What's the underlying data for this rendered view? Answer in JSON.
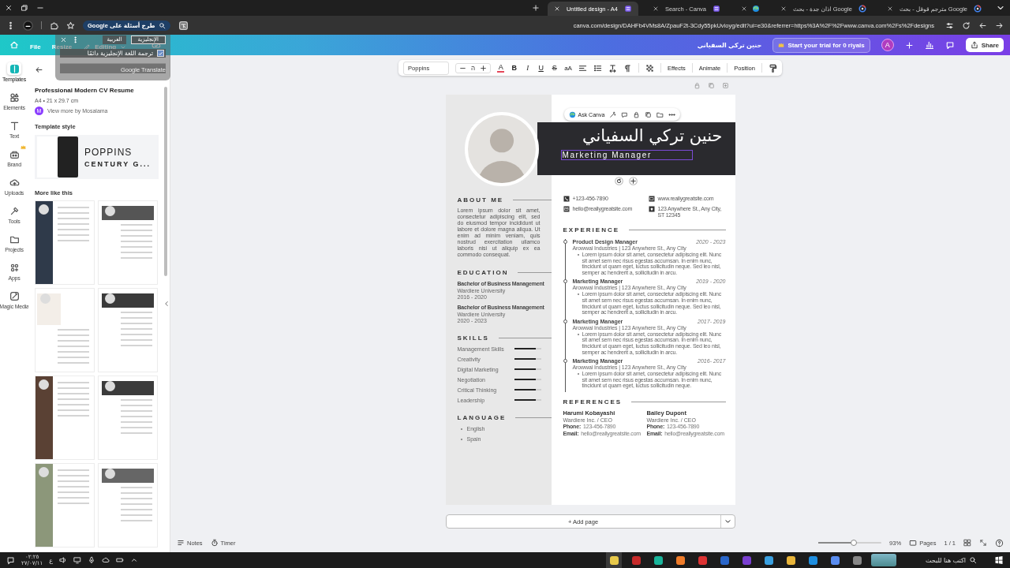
{
  "browser": {
    "tabs": [
      {
        "kind": "page",
        "title": "Untitled design - A4",
        "selected": true
      },
      {
        "kind": "page",
        "title": "Search - Canva",
        "selected": false
      },
      {
        "kind": "pinned",
        "selected": false
      },
      {
        "kind": "page",
        "title": "اذان جدة - بحث Google",
        "selected": false
      },
      {
        "kind": "page",
        "title": "مترجم قوقل - بحث Google",
        "selected": false
      }
    ],
    "ask_google": "طرح أسئلة على Google",
    "url": "canva.com/design/DAHFb4VMs8A/ZpauF2t-3Cdy55pkUvioyg/edit?ui=e30&referrer=https%3A%2F%2Fwww.canva.com%2Fs%2Fdesigns"
  },
  "translate_popup": {
    "languages": [
      {
        "label": "الإنجليزية",
        "selected": true
      },
      {
        "label": "العربية",
        "selected": false
      }
    ],
    "always": {
      "label": "ترجمة اللغة الإنجليزية دائمًا",
      "checked": true
    },
    "footer": "Google Translate"
  },
  "header": {
    "menu": [
      "File",
      "Resize",
      "Editing"
    ],
    "design_title": "حنين تركي السفياني",
    "trial": "Start your trial for 0 riyals",
    "avatar": "A",
    "share": "Share"
  },
  "rail": [
    {
      "label": "Templates",
      "selected": true,
      "premium": false
    },
    {
      "label": "Elements",
      "selected": false,
      "premium": false
    },
    {
      "label": "Text",
      "selected": false,
      "premium": false
    },
    {
      "label": "Brand",
      "selected": false,
      "premium": true
    },
    {
      "label": "Uploads",
      "selected": false,
      "premium": false
    },
    {
      "label": "Tools",
      "selected": false,
      "premium": false
    },
    {
      "label": "Projects",
      "selected": false,
      "premium": false
    },
    {
      "label": "Apps",
      "selected": false,
      "premium": false
    },
    {
      "label": "Magic Media",
      "selected": false,
      "premium": false
    }
  ],
  "panel": {
    "title": "Professional Modern CV Resume",
    "size": "A4 • 21 x 29.7 cm",
    "author_initial": "M",
    "author_link": "View more by Mosalama",
    "style_heading": "Template style",
    "style_fonts": [
      "POPPINS",
      "CENTURY G..."
    ],
    "more_heading": "More like this"
  },
  "text_toolbar": {
    "font": "Poppins",
    "size": "ה",
    "text_color": "A",
    "format": [
      {
        "kind": "bold",
        "label": "B"
      },
      {
        "kind": "italic",
        "label": "I"
      },
      {
        "kind": "underline",
        "label": "U"
      },
      {
        "kind": "strike",
        "label": "S"
      },
      {
        "kind": "case",
        "label": "aA"
      }
    ],
    "actions": [
      "Effects",
      "Animate",
      "Position"
    ]
  },
  "ask_canva": "Ask Canva",
  "resume": {
    "name": "حنين تركي السفياني",
    "title": "Marketing Manager",
    "about": {
      "heading": "ABOUT ME",
      "text": "Lorem ipsum dolor sit amet, consectetur adipiscing elit, sed do eiusmod tempor incididunt ut labore et dolore magna aliqua. Ut enim ad minim veniam, quis nostrud exercitation ullamco laboris nisi ut aliquip ex ea commodo consequat."
    },
    "education": {
      "heading": "EDUCATION",
      "entries": [
        {
          "degree": "Bachelor of Business Management",
          "school": "Wardiere University",
          "years": "2016 - 2020"
        },
        {
          "degree": "Bachelor of Business Management",
          "school": "Wardiere University",
          "years": "2020 - 2023"
        }
      ]
    },
    "skills": {
      "heading": "SKILLS",
      "items": [
        {
          "name": "Management Skills",
          "level": 0.8
        },
        {
          "name": "Creativity",
          "level": 0.8
        },
        {
          "name": "Digital Marketing",
          "level": 0.8
        },
        {
          "name": "Negotiation",
          "level": 0.8
        },
        {
          "name": "Critical Thinking",
          "level": 0.8
        },
        {
          "name": "Leadership",
          "level": 0.8
        }
      ]
    },
    "language": {
      "heading": "LANGUAGE",
      "items": [
        "English",
        "Spain"
      ]
    },
    "contacts": [
      {
        "kind": "phone",
        "text": "+123-456-7890"
      },
      {
        "kind": "web",
        "text": "www.reallygreatsite.com"
      },
      {
        "kind": "email",
        "text": "hello@reallygreatsite.com"
      },
      {
        "kind": "address",
        "text": "123 Anywhere St., Any City, ST 12345"
      }
    ],
    "experience": {
      "heading": "EXPERIENCE",
      "jobs": [
        {
          "title": "Product Design Manager",
          "dates": "2020 - 2023",
          "company": "Arowwai Industries | 123 Anywhere St., Any City",
          "text": "Lorem ipsum dolor sit amet, consectetur adipiscing elit. Nunc sit amet sem nec risus egestas accumsan. In enim nunc, tincidunt ut quam eget, luctus sollicitudin neque. Sed leo nisl, semper ac hendrerit a, sollicitudin in arcu."
        },
        {
          "title": "Marketing Manager",
          "dates": "2019 - 2020",
          "company": "Arowwai Industries | 123 Anywhere St., Any City",
          "text": "Lorem ipsum dolor sit amet, consectetur adipiscing elit. Nunc sit amet sem nec risus egestas accumsan. In enim nunc, tincidunt ut quam eget, luctus sollicitudin neque. Sed leo nisl, semper ac hendrerit a, sollicitudin in arcu."
        },
        {
          "title": "Marketing Manager",
          "dates": "2017- 2019",
          "company": "Arowwai Industries | 123 Anywhere St., Any City",
          "text": "Lorem ipsum dolor sit amet, consectetur adipiscing elit. Nunc sit amet sem nec risus egestas accumsan. In enim nunc, tincidunt ut quam eget, luctus sollicitudin neque. Sed leo nisl, semper ac hendrerit a, sollicitudin in arcu."
        },
        {
          "title": "Marketing Manager",
          "dates": "2016- 2017",
          "company": "Arowwai Industries | 123 Anywhere St., Any City",
          "text": "Lorem ipsum dolor sit amet, consectetur adipiscing elit. Nunc sit amet sem nec risus egestas accumsan. In enim nunc, tincidunt ut quam eget, luctus sollicitudin neque."
        }
      ]
    },
    "references": {
      "heading": "REFERENCES",
      "people": [
        {
          "name": "Harumi Kobayashi",
          "role": "Wardiere Inc. / CEO",
          "phone_label": "Phone:",
          "phone": "123-456-7890",
          "email_label": "Email:",
          "email": "hello@reallygreatsite.com"
        },
        {
          "name": "Bailey Dupont",
          "role": "Wardiere Inc. / CEO",
          "phone_label": "Phone:",
          "phone": "123-456-7890",
          "email_label": "Email:",
          "email": "hello@reallygreatsite.com"
        }
      ]
    }
  },
  "add_page": "+ Add page",
  "footer": {
    "notes": "Notes",
    "timer": "Timer",
    "zoom": {
      "level": 0.56,
      "reading": "93%"
    },
    "pages": "Pages",
    "page_count": "1 / 1"
  },
  "taskbar": {
    "search": {
      "placeholder": "اكتب هنا للبحث"
    },
    "time": "٠٢:٢٥",
    "date": "٢٧/٠٧/١١",
    "language": "ع"
  }
}
